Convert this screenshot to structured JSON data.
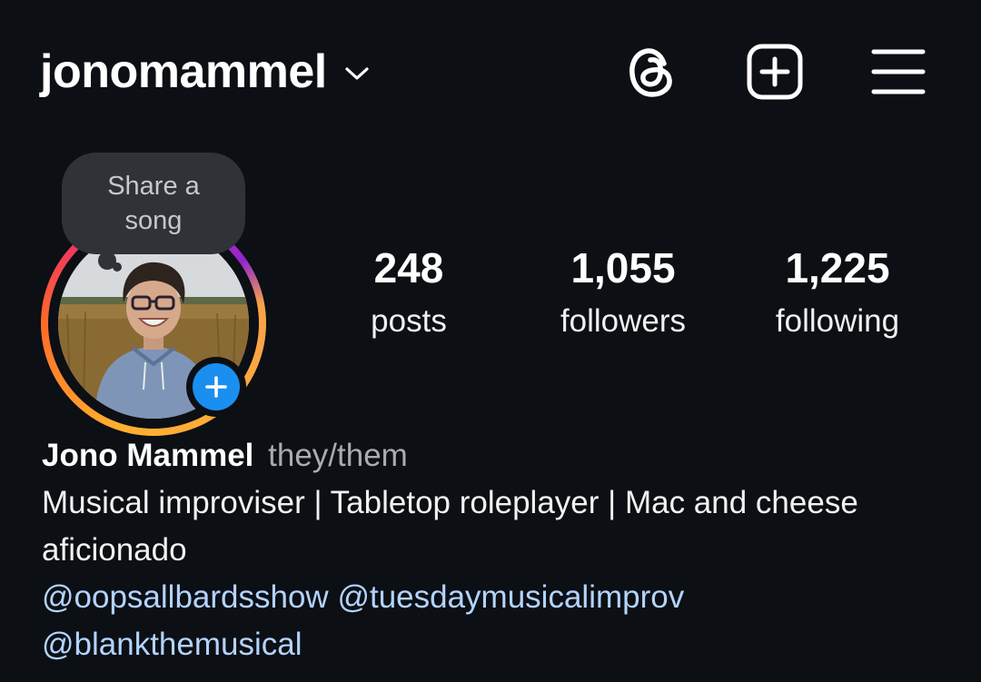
{
  "header": {
    "username": "jonomammel",
    "icons": [
      "chevron-down-icon",
      "threads-icon",
      "create-post-icon",
      "menu-icon"
    ]
  },
  "note": {
    "text": "Share a song"
  },
  "stats": {
    "posts": {
      "value": "248",
      "label": "posts"
    },
    "followers": {
      "value": "1,055",
      "label": "followers"
    },
    "following": {
      "value": "1,225",
      "label": "following"
    }
  },
  "bio": {
    "full_name": "Jono Mammel",
    "pronouns": "they/them",
    "text": "Musical improviser | Tabletop roleplayer | Mac and cheese aficionado",
    "mentions": [
      "@oopsallbardsshow",
      "@tuesdaymusicalimprov",
      "@blankthemusical"
    ]
  },
  "colors": {
    "background": "#0c0f14",
    "mention": "#b3d3ff",
    "add_story": "#1a8ff0",
    "note_bubble": "#2f3237"
  }
}
